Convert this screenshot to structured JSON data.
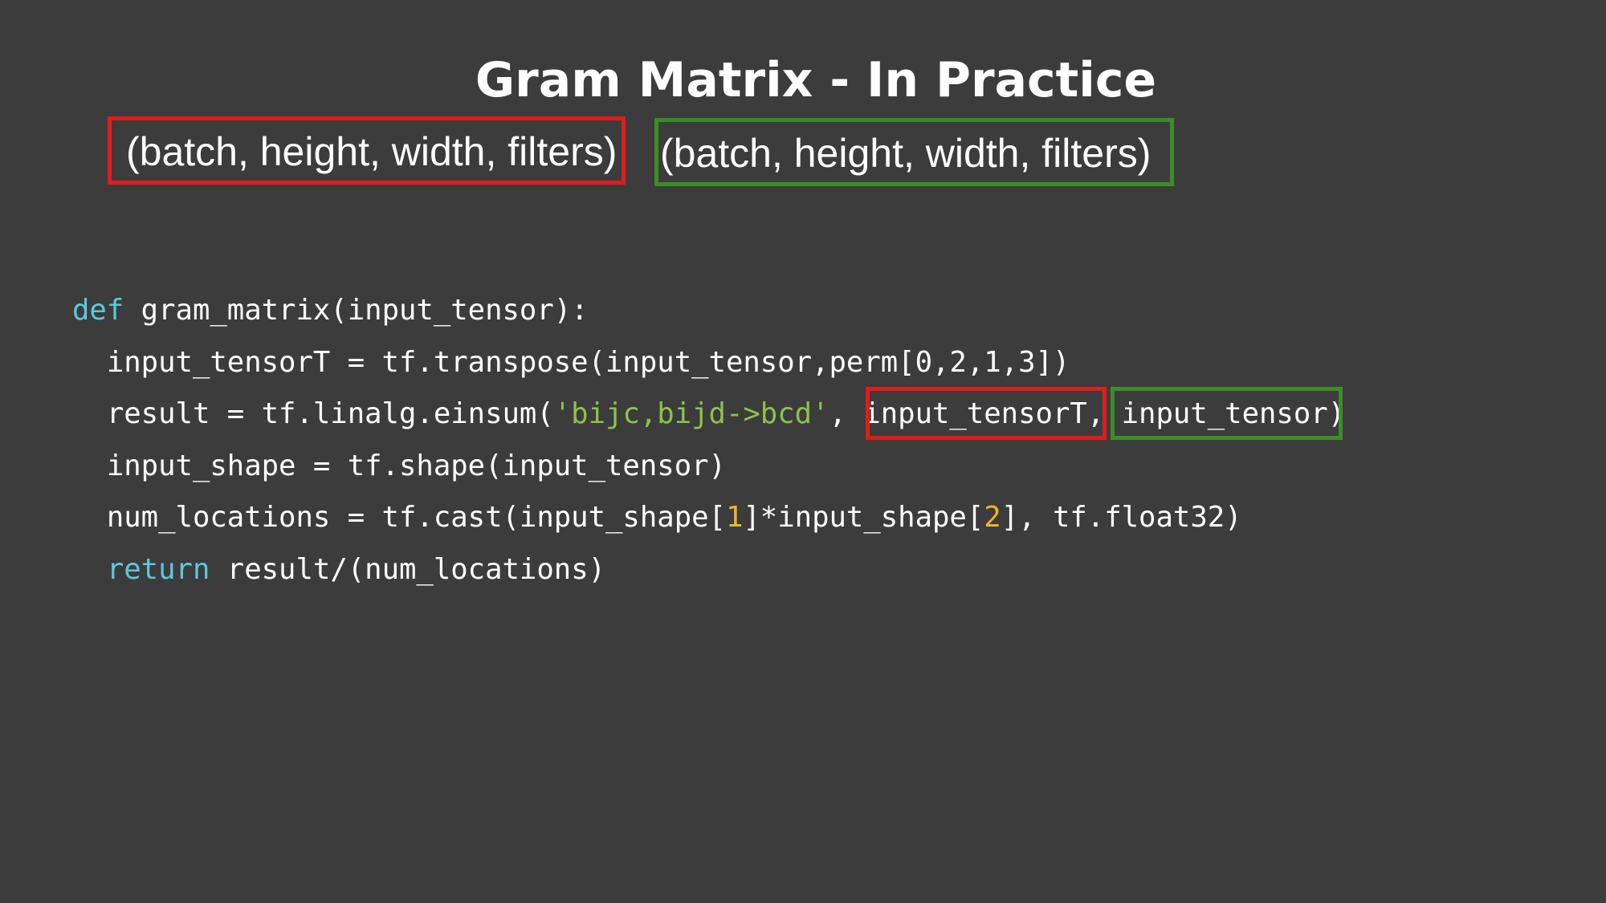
{
  "slide": {
    "title": "Gram Matrix - In Practice",
    "shape_left": "(batch, height, width, filters)",
    "shape_right": "(batch, height, width, filters)"
  },
  "code": {
    "line1": {
      "kw": "def",
      "rest": " gram_matrix(input_tensor):"
    },
    "line2": {
      "text": "  input_tensorT = tf.transpose(input_tensor,perm[0,2,1,3])"
    },
    "line3": {
      "pre": "  result = tf.linalg.einsum(",
      "str": "'bijc,bijd->bcd'",
      "arg1": ", input_tensorT",
      "arg2": ", input_tensor",
      "post": ")"
    },
    "line4": {
      "text": "  input_shape = tf.shape(input_tensor)"
    },
    "line5": {
      "pre": "  num_locations = tf.cast(input_shape[",
      "n1": "1",
      "mid": "]*input_shape[",
      "n2": "2",
      "post": "], tf.float32)"
    },
    "line6": {
      "indent": "  ",
      "kw": "return",
      "rest": " result/(num_locations)"
    }
  },
  "colors": {
    "background": "#3c3c3c",
    "red_highlight": "#e31b1b",
    "green_highlight": "#3d8d27",
    "keyword": "#5cc8dc",
    "string": "#8bc34a",
    "number": "#f0b429"
  }
}
